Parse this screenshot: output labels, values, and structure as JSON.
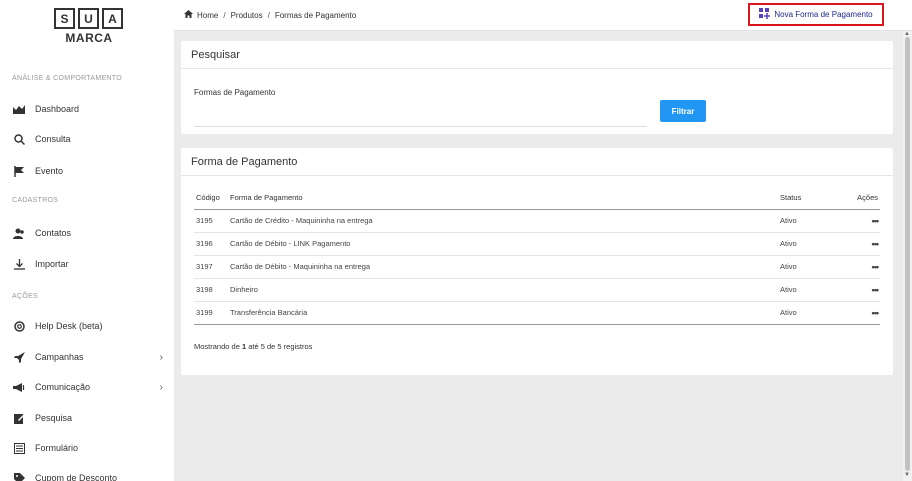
{
  "logo": {
    "letters": [
      "S",
      "U",
      "A"
    ],
    "word": "MARCA"
  },
  "sidebar": {
    "sections": [
      {
        "label": "ANÁLISE & COMPORTAMENTO"
      },
      {
        "label": "CADASTROS"
      },
      {
        "label": "AÇÕES"
      }
    ],
    "items": [
      {
        "label": "Dashboard",
        "icon": "chart-icon"
      },
      {
        "label": "Consulta",
        "icon": "search-icon"
      },
      {
        "label": "Evento",
        "icon": "flag-icon"
      },
      {
        "label": "Contatos",
        "icon": "users-icon"
      },
      {
        "label": "Importar",
        "icon": "download-icon"
      },
      {
        "label": "Help Desk (beta)",
        "icon": "lifebuoy-icon"
      },
      {
        "label": "Campanhas",
        "icon": "rocket-icon"
      },
      {
        "label": "Comunicação",
        "icon": "megaphone-icon"
      },
      {
        "label": "Pesquisa",
        "icon": "edit-icon"
      },
      {
        "label": "Formulário",
        "icon": "form-icon"
      },
      {
        "label": "Cupom de Desconto",
        "icon": "tag-icon"
      }
    ]
  },
  "breadcrumb": {
    "items": [
      "Home",
      "Produtos",
      "Formas de Pagamento"
    ],
    "separator": "/"
  },
  "header": {
    "new_button": "Nova Forma de Pagamento"
  },
  "search_panel": {
    "title": "Pesquisar",
    "field_label": "Formas de Pagamento",
    "field_value": "",
    "filter_button": "Filtrar"
  },
  "table_panel": {
    "title": "Forma de Pagamento",
    "columns": [
      "Código",
      "Forma de Pagamento",
      "Status",
      "Ações"
    ],
    "rows": [
      {
        "code": "3195",
        "name": "Cartão de Crédito - Maquininha na entrega",
        "status": "Ativo",
        "actions": "•••"
      },
      {
        "code": "3196",
        "name": "Cartão de Débito - LINK Pagamento",
        "status": "Ativo",
        "actions": "•••"
      },
      {
        "code": "3197",
        "name": "Cartão de Débito - Maquininha na entrega",
        "status": "Ativo",
        "actions": "•••"
      },
      {
        "code": "3198",
        "name": "Dinheiro",
        "status": "Ativo",
        "actions": "•••"
      },
      {
        "code": "3199",
        "name": "Transferência Bancária",
        "status": "Ativo",
        "actions": "•••"
      }
    ],
    "records_prefix": "Mostrando de ",
    "records_from": "1",
    "records_mid": " até 5 de 5 registros"
  },
  "colors": {
    "accent": "#2196f3",
    "highlight_border": "#d9161b",
    "link": "#1b2a8a"
  }
}
